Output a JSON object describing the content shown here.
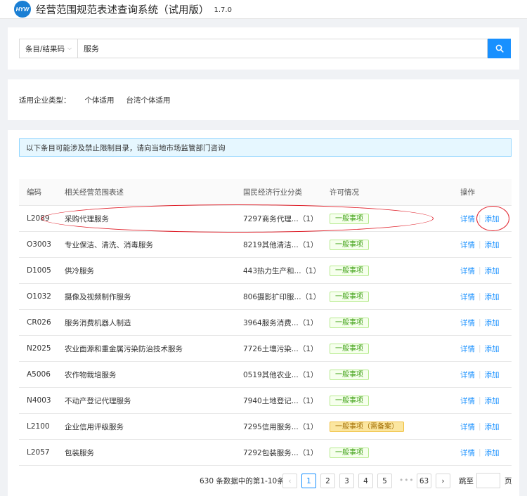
{
  "app": {
    "logo_text": "HYW",
    "title": "经营范围规范表述查询系统（试用版）",
    "version": "1.7.0"
  },
  "search": {
    "type_label": "条目/结果码",
    "query": "服务"
  },
  "filter": {
    "label": "适用企业类型：",
    "options": [
      "个体适用",
      "台湾个体适用"
    ]
  },
  "alert": {
    "text": "以下条目可能涉及禁止限制目录，请向当地市场监管部门咨询"
  },
  "table": {
    "headers": {
      "code": "编码",
      "desc": "相关经营范围表述",
      "industry": "国民经济行业分类",
      "license": "许可情况",
      "ops": "操作"
    },
    "rows": [
      {
        "code": "L2089",
        "desc": "采购代理服务",
        "industry": "7297商务代理...（1）",
        "license": "一般事项"
      },
      {
        "code": "O3003",
        "desc": "专业保洁、清洗、消毒服务",
        "industry": "8219其他清洁...（1）",
        "license": "一般事项"
      },
      {
        "code": "D1005",
        "desc": "供冷服务",
        "industry": "443热力生产和...（1）",
        "license": "一般事项"
      },
      {
        "code": "O1032",
        "desc": "摄像及视频制作服务",
        "industry": "806摄影扩印服...（1）",
        "license": "一般事项"
      },
      {
        "code": "CR026",
        "desc": "服务消费机器人制造",
        "industry": "3964服务消费...（1）",
        "license": "一般事项"
      },
      {
        "code": "N2025",
        "desc": "农业面源和重金属污染防治技术服务",
        "industry": "7726土壤污染...（1）",
        "license": "一般事项"
      },
      {
        "code": "A5006",
        "desc": "农作物栽培服务",
        "industry": "0519其他农业...（1）",
        "license": "一般事项"
      },
      {
        "code": "N4003",
        "desc": "不动产登记代理服务",
        "industry": "7940土地登记...（1）",
        "license": "一般事项"
      },
      {
        "code": "L2100",
        "desc": "企业信用评级服务",
        "industry": "7295信用服务...（1）",
        "license": "一般事项（需备案）"
      },
      {
        "code": "L2057",
        "desc": "包装服务",
        "industry": "7292包装服务...（1）",
        "license": "一般事项"
      }
    ],
    "detail_label": "详情",
    "add_label": "添加"
  },
  "pagination": {
    "total_text": "630 条数据中的第1-10条",
    "prev": "‹",
    "pages": [
      "1",
      "2",
      "3",
      "4",
      "5"
    ],
    "ellipsis": "•••",
    "last_page": "63",
    "next": "›",
    "jump_label": "跳至",
    "page_unit": "页",
    "current": 1
  },
  "colors": {
    "primary": "#1890ff",
    "tag_general_bg": "#f6ffed",
    "tag_general_border": "#b7eb8f",
    "tag_general_text": "#389e0d",
    "tag_filing_bg": "#fbe6a0",
    "tag_filing_text": "#a16c00",
    "annotation_red": "#e0202a",
    "alert_bg": "#e6f7ff"
  }
}
